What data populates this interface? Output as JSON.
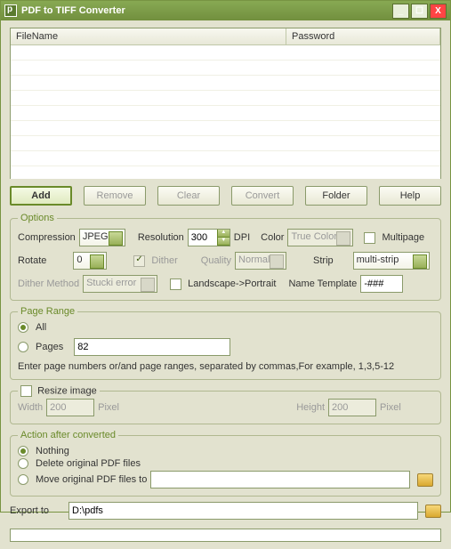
{
  "title": "PDF to TIFF Converter",
  "grid": {
    "col1": "FileName",
    "col2": "Password"
  },
  "buttons": {
    "add": "Add",
    "remove": "Remove",
    "clear": "Clear",
    "convert": "Convert",
    "folder": "Folder",
    "help": "Help"
  },
  "options": {
    "legend": "Options",
    "compression_lbl": "Compression",
    "compression_val": "JPEG",
    "resolution_lbl": "Resolution",
    "resolution_val": "300",
    "dpi": "DPI",
    "color_lbl": "Color",
    "color_val": "True Color",
    "multipage_lbl": "Multipage",
    "rotate_lbl": "Rotate",
    "rotate_val": "0",
    "dither_lbl": "Dither",
    "quality_lbl": "Quality",
    "quality_val": "Normal",
    "strip_lbl": "Strip",
    "strip_val": "multi-strip",
    "dithermethod_lbl": "Dither Method",
    "dithermethod_val": "Stucki error",
    "landscape_lbl": "Landscape->Portrait",
    "nametpl_lbl": "Name Template",
    "nametpl_val": "-###"
  },
  "pagerange": {
    "legend": "Page Range",
    "all": "All",
    "pages": "Pages",
    "pages_val": "82",
    "hint": "Enter page numbers or/and page ranges, separated by commas,For example, 1,3,5-12"
  },
  "resize": {
    "legend_lbl": "Resize image",
    "width_lbl": "Width",
    "width_val": "200",
    "pixel": "Pixel",
    "height_lbl": "Height",
    "height_val": "200"
  },
  "action": {
    "legend": "Action after converted",
    "nothing": "Nothing",
    "delete": "Delete original PDF files",
    "move": "Move original PDF files to"
  },
  "export": {
    "lbl": "Export to",
    "val": "D:\\pdfs"
  }
}
